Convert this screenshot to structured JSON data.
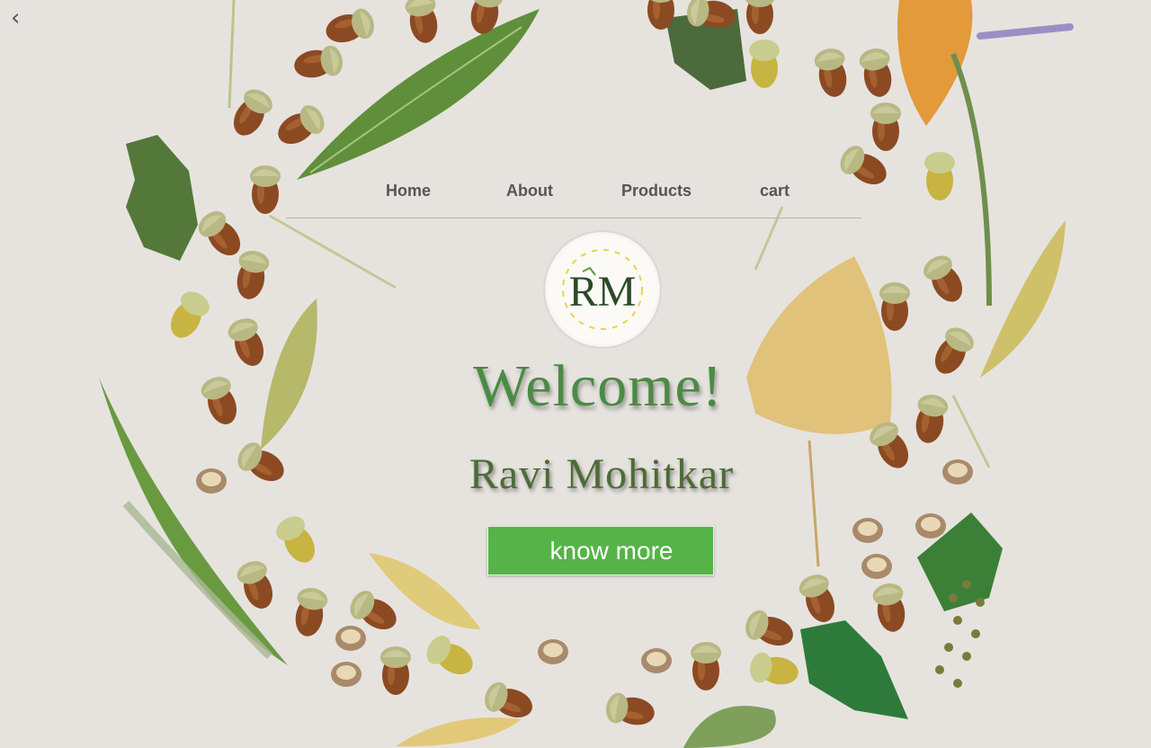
{
  "nav": {
    "back_icon": "chevron-left-icon",
    "items": [
      "Home",
      "About",
      "Products",
      "cart"
    ]
  },
  "logo": {
    "letters": "RM"
  },
  "hero": {
    "title": "Welcome!",
    "name": "Ravi Mohitkar",
    "cta_label": "know more"
  },
  "colors": {
    "background": "#e6e3df",
    "title_green": "#4b8b45",
    "name_green": "#4e6b36",
    "button_green": "#55b347",
    "nav_text": "#555555",
    "acorn_brown": "#8b4a22",
    "acorn_cap": "#b7c28a",
    "leaf_green": "#5f8f3a",
    "leaf_yellow": "#dcc377"
  }
}
